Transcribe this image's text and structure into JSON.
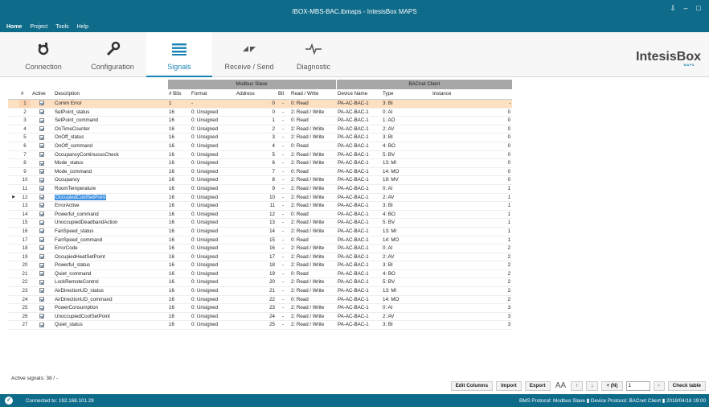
{
  "window": {
    "title": "IBOX-MBS-BAC.ibmaps - IntesisBox MAPS",
    "controls": [
      "⇩",
      "–",
      "□"
    ]
  },
  "menu": [
    "Home",
    "Project",
    "Tools",
    "Help"
  ],
  "nav": [
    {
      "label": "Connection",
      "icon": "connection-plug-icon"
    },
    {
      "label": "Configuration",
      "icon": "wrench-icon"
    },
    {
      "label": "Signals",
      "icon": "list-icon"
    },
    {
      "label": "Receive / Send",
      "icon": "transfer-icon"
    },
    {
      "label": "Diagnostic",
      "icon": "pulse-icon"
    }
  ],
  "brand": {
    "name": "IntesisBox",
    "sub": "MAPS"
  },
  "table": {
    "group_modbus": "Modbus Slave",
    "group_bacnet": "BACnet Client",
    "columns": [
      "#",
      "Active",
      "Description",
      "# Bits",
      "Format",
      "Address",
      "Bit",
      "Read / Write",
      "Device Name",
      "Type",
      "Instance"
    ],
    "rows": [
      [
        "1",
        "Comm Error",
        "1",
        "-",
        "0",
        "-",
        "0: Read",
        "PA-AC-BAC-1",
        "3: BI",
        "-"
      ],
      [
        "2",
        "SetPoint_status",
        "16",
        "0: Unsigned",
        "0",
        "-",
        "2: Read / Write",
        "PA-AC-BAC-1",
        "0: AI",
        "0"
      ],
      [
        "3",
        "SetPoint_command",
        "16",
        "0: Unsigned",
        "1",
        "-",
        "0: Read",
        "PA-AC-BAC-1",
        "1: AO",
        "0"
      ],
      [
        "4",
        "OnTimeCounter",
        "16",
        "0: Unsigned",
        "2",
        "-",
        "2: Read / Write",
        "PA-AC-BAC-1",
        "2: AV",
        "0"
      ],
      [
        "5",
        "OnOff_status",
        "16",
        "0: Unsigned",
        "3",
        "-",
        "2: Read / Write",
        "PA-AC-BAC-1",
        "3: BI",
        "0"
      ],
      [
        "6",
        "OnOff_command",
        "16",
        "0: Unsigned",
        "4",
        "-",
        "0: Read",
        "PA-AC-BAC-1",
        "4: BO",
        "0"
      ],
      [
        "7",
        "OccupancyContinuousCheck",
        "16",
        "0: Unsigned",
        "5",
        "-",
        "2: Read / Write",
        "PA-AC-BAC-1",
        "5: BV",
        "0"
      ],
      [
        "8",
        "Mode_status",
        "16",
        "0: Unsigned",
        "6",
        "-",
        "2: Read / Write",
        "PA-AC-BAC-1",
        "13: MI",
        "0"
      ],
      [
        "9",
        "Mode_command",
        "16",
        "0: Unsigned",
        "7",
        "-",
        "0: Read",
        "PA-AC-BAC-1",
        "14: MO",
        "0"
      ],
      [
        "10",
        "Occupancy",
        "16",
        "0: Unsigned",
        "8",
        "-",
        "2: Read / Write",
        "PA-AC-BAC-1",
        "19: MV",
        "0"
      ],
      [
        "11",
        "RoomTemperature",
        "16",
        "0: Unsigned",
        "9",
        "-",
        "2: Read / Write",
        "PA-AC-BAC-1",
        "0: AI",
        "1"
      ],
      [
        "12",
        "OccupiedCoolSetPoint",
        "16",
        "0: Unsigned",
        "10",
        "-",
        "2: Read / Write",
        "PA-AC-BAC-1",
        "2: AV",
        "1"
      ],
      [
        "13",
        "ErrorActive",
        "16",
        "0: Unsigned",
        "11",
        "-",
        "2: Read / Write",
        "PA-AC-BAC-1",
        "3: BI",
        "1"
      ],
      [
        "14",
        "Powerful_command",
        "16",
        "0: Unsigned",
        "12",
        "-",
        "0: Read",
        "PA-AC-BAC-1",
        "4: BO",
        "1"
      ],
      [
        "15",
        "UnoccupiedDeadbandAction",
        "16",
        "0: Unsigned",
        "13",
        "-",
        "2: Read / Write",
        "PA-AC-BAC-1",
        "5: BV",
        "1"
      ],
      [
        "16",
        "FanSpeed_status",
        "16",
        "0: Unsigned",
        "14",
        "-",
        "2: Read / Write",
        "PA-AC-BAC-1",
        "13: MI",
        "1"
      ],
      [
        "17",
        "FanSpeed_command",
        "16",
        "0: Unsigned",
        "15",
        "-",
        "0: Read",
        "PA-AC-BAC-1",
        "14: MO",
        "1"
      ],
      [
        "18",
        "ErrorCode",
        "16",
        "0: Unsigned",
        "16",
        "-",
        "2: Read / Write",
        "PA-AC-BAC-1",
        "0: AI",
        "2"
      ],
      [
        "19",
        "OccupiedHeatSetPoint",
        "16",
        "0: Unsigned",
        "17",
        "-",
        "2: Read / Write",
        "PA-AC-BAC-1",
        "2: AV",
        "2"
      ],
      [
        "20",
        "Powerful_status",
        "16",
        "0: Unsigned",
        "18",
        "-",
        "2: Read / Write",
        "PA-AC-BAC-1",
        "3: BI",
        "2"
      ],
      [
        "21",
        "Quiet_command",
        "16",
        "0: Unsigned",
        "19",
        "-",
        "0: Read",
        "PA-AC-BAC-1",
        "4: BO",
        "2"
      ],
      [
        "22",
        "LockRemoteControl",
        "16",
        "0: Unsigned",
        "20",
        "-",
        "2: Read / Write",
        "PA-AC-BAC-1",
        "5: BV",
        "2"
      ],
      [
        "23",
        "AirDirectionUD_status",
        "16",
        "0: Unsigned",
        "21",
        "-",
        "2: Read / Write",
        "PA-AC-BAC-1",
        "13: MI",
        "2"
      ],
      [
        "24",
        "AirDirectionUD_command",
        "16",
        "0: Unsigned",
        "22",
        "-",
        "0: Read",
        "PA-AC-BAC-1",
        "14: MO",
        "2"
      ],
      [
        "25",
        "PowerConsumption",
        "16",
        "0: Unsigned",
        "23",
        "-",
        "2: Read / Write",
        "PA-AC-BAC-1",
        "0: AI",
        "3"
      ],
      [
        "26",
        "UnoccupiedCoolSetPoint",
        "16",
        "0: Unsigned",
        "24",
        "-",
        "2: Read / Write",
        "PA-AC-BAC-1",
        "2: AV",
        "3"
      ],
      [
        "27",
        "Quiet_status",
        "16",
        "0: Unsigned",
        "25",
        "-",
        "2: Read / Write",
        "PA-AC-BAC-1",
        "3: BI",
        "3"
      ]
    ],
    "selected_row": 12,
    "error_row": 1,
    "row_marker": "▶"
  },
  "active_signals": "Active signals:  38 / -",
  "toolbar": {
    "edit_columns": "Edit Columns",
    "import": "Import",
    "export": "Export",
    "font_size": "AA",
    "up": "↑",
    "down": "↓",
    "add_n": "+ (N)",
    "count": "1",
    "minus": "-",
    "check_table": "Check table"
  },
  "status": {
    "connection": "Connected to: 192.168.101.29",
    "right": "BMS Protocol: Modbus Slave  ▮  Device Protocol: BACnet Client  ▮  2018/04/18 19:00"
  },
  "colors": {
    "accent": "#0e6b8a",
    "error_row": "#fde0c2",
    "selection": "#3b8ee0"
  }
}
